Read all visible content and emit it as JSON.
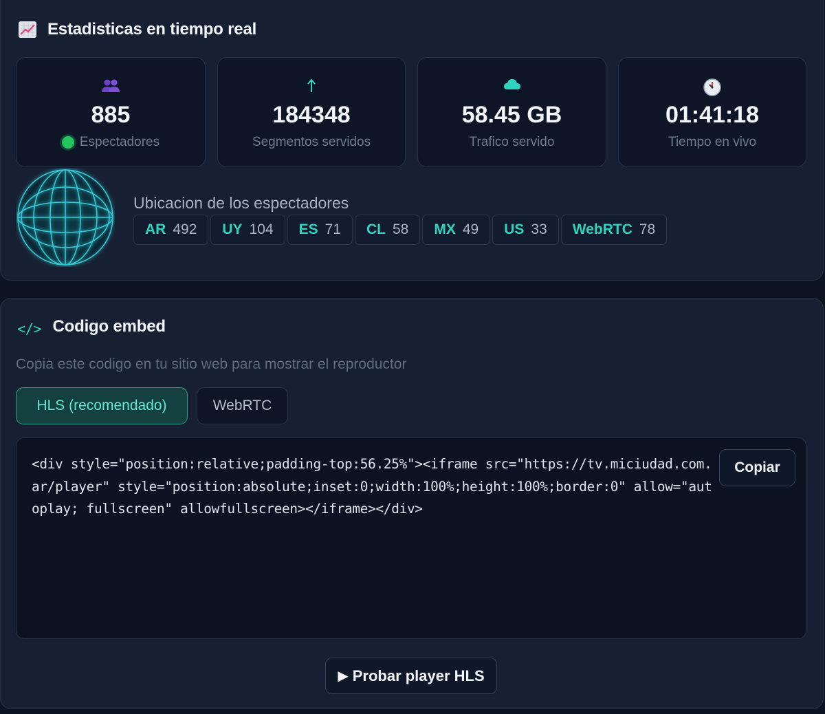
{
  "stats": {
    "title": "Estadisticas en tiempo real",
    "icon": "chart-increasing-icon",
    "cards": [
      {
        "icon": "users-icon",
        "value": "885",
        "label": "Espectadores",
        "live": true
      },
      {
        "icon": "arrow-up-icon",
        "value": "184348",
        "label": "Segmentos servidos"
      },
      {
        "icon": "cloud-icon",
        "value": "58.45 GB",
        "label": "Trafico servido"
      },
      {
        "icon": "clock-icon",
        "value": "01:41:18",
        "label": "Tiempo en vivo"
      }
    ],
    "geo": {
      "title": "Ubicacion de los espectadores",
      "icon": "globe-icon",
      "chips": [
        {
          "code": "AR",
          "count": "492"
        },
        {
          "code": "UY",
          "count": "104"
        },
        {
          "code": "ES",
          "count": "71"
        },
        {
          "code": "CL",
          "count": "58"
        },
        {
          "code": "MX",
          "count": "49"
        },
        {
          "code": "US",
          "count": "33"
        },
        {
          "code": "WebRTC",
          "count": "78"
        }
      ]
    }
  },
  "embed": {
    "icon_text": "</>",
    "title": "Codigo embed",
    "description": "Copia este codigo en tu sitio web para mostrar el reproductor",
    "tabs": [
      {
        "label": "HLS (recomendado)",
        "active": true
      },
      {
        "label": "WebRTC",
        "active": false
      }
    ],
    "code": "<div style=\"position:relative;padding-top:56.25%\"><iframe src=\"https://tv.miciudad.com.ar/player\" style=\"position:absolute;inset:0;width:100%;height:100%;border:0\" allow=\"autoplay; fullscreen\" allowfullscreen></iframe></div>",
    "copy_label": "Copiar",
    "try_label": "Probar player HLS",
    "try_icon": "▶"
  },
  "colors": {
    "accent": "#2dd4bf",
    "live": "#22c55e",
    "background": "#0c1322",
    "panel": "#172032"
  }
}
